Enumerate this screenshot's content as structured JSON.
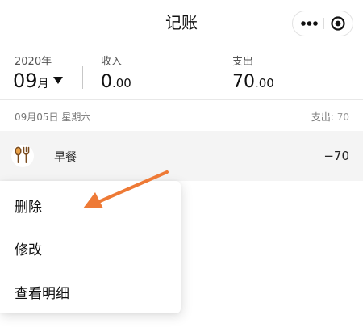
{
  "navbar": {
    "title": "记账",
    "menu_icon": "more-dots-icon",
    "close_icon": "close-target-icon"
  },
  "summary": {
    "year": "2020年",
    "month": "09",
    "month_unit": "月",
    "income_label": "收入",
    "income_int": "0",
    "income_dec": ".00",
    "expense_label": "支出",
    "expense_int": "70",
    "expense_dec": ".00"
  },
  "day": {
    "date": "09月05日 星期六",
    "total_label": "支出:",
    "total_value": " 70"
  },
  "records": [
    {
      "icon": "fork-spoon-icon",
      "name": "早餐",
      "amount": "−70"
    }
  ],
  "context_menu": {
    "items": [
      "删除",
      "修改",
      "查看明细"
    ]
  },
  "colors": {
    "arrow": "#ee7a36",
    "icon_brown": "#7a4b1e",
    "row_bg": "#f4f4f4"
  }
}
